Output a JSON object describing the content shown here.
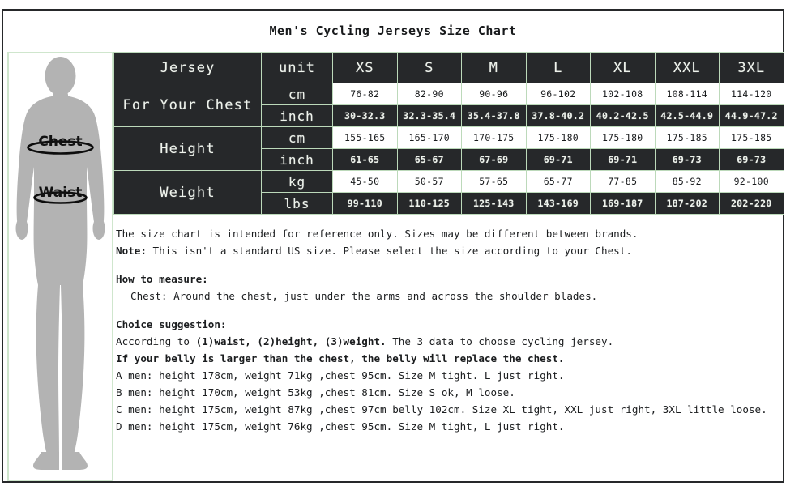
{
  "title": "Men's Cycling Jerseys Size Chart",
  "figure": {
    "chest_label": "Chest",
    "waist_label": "Waist"
  },
  "table": {
    "header": [
      "Jersey",
      "unit",
      "XS",
      "S",
      "M",
      "L",
      "XL",
      "XXL",
      "3XL"
    ],
    "groups": [
      {
        "label": "For Your Chest",
        "rows": [
          {
            "unit": "cm",
            "style": "light",
            "values": [
              "76-82",
              "82-90",
              "90-96",
              "96-102",
              "102-108",
              "108-114",
              "114-120"
            ]
          },
          {
            "unit": "inch",
            "style": "dark",
            "values": [
              "30-32.3",
              "32.3-35.4",
              "35.4-37.8",
              "37.8-40.2",
              "40.2-42.5",
              "42.5-44.9",
              "44.9-47.2"
            ]
          }
        ]
      },
      {
        "label": "Height",
        "rows": [
          {
            "unit": "cm",
            "style": "light",
            "values": [
              "155-165",
              "165-170",
              "170-175",
              "175-180",
              "175-180",
              "175-185",
              "175-185"
            ]
          },
          {
            "unit": "inch",
            "style": "dark",
            "values": [
              "61-65",
              "65-67",
              "67-69",
              "69-71",
              "69-71",
              "69-73",
              "69-73"
            ]
          }
        ]
      },
      {
        "label": "Weight",
        "rows": [
          {
            "unit": "kg",
            "style": "light",
            "values": [
              "45-50",
              "50-57",
              "57-65",
              "65-77",
              "77-85",
              "85-92",
              "92-100"
            ]
          },
          {
            "unit": "lbs",
            "style": "dark",
            "values": [
              "99-110",
              "110-125",
              "125-143",
              "143-169",
              "169-187",
              "187-202",
              "202-220"
            ]
          }
        ]
      }
    ]
  },
  "notes": {
    "disclaimer": "The size chart is intended for reference only. Sizes may be different between brands.",
    "note_label": "Note:",
    "note_body": " This isn't a standard US size. Please select the size according to your Chest.",
    "how_to_measure_heading": "How to measure:",
    "how_to_measure_body": "Chest: Around the chest, just under the arms and across the shoulder blades.",
    "choice_heading": "Choice suggestion:",
    "choice_line_plain_prefix": "According to ",
    "choice_line_bold": "(1)waist, (2)height, (3)weight.",
    "choice_line_plain_suffix": " The 3 data to choose cycling jersey.",
    "belly_line": "If your belly is larger than the chest, the belly will replace the chest.",
    "examples": [
      "A men: height 178cm, weight 71kg ,chest 95cm. Size M tight. L just right.",
      "B men: height 170cm, weight 53kg ,chest 81cm. Size S ok, M loose.",
      "C men: height 175cm, weight 87kg ,chest 97cm belly 102cm. Size XL tight, XXL just right, 3XL little loose.",
      "D men: height 175cm, weight 76kg ,chest 95cm. Size M tight, L just right."
    ]
  },
  "colors": {
    "dark_cell": "#26282a",
    "light_cell": "#ffffff",
    "border_green": "#bcd9ba",
    "panel_border": "#cfe6cd",
    "body_gray": "#b3b3b3",
    "text_dark": "#1a1c1e"
  }
}
